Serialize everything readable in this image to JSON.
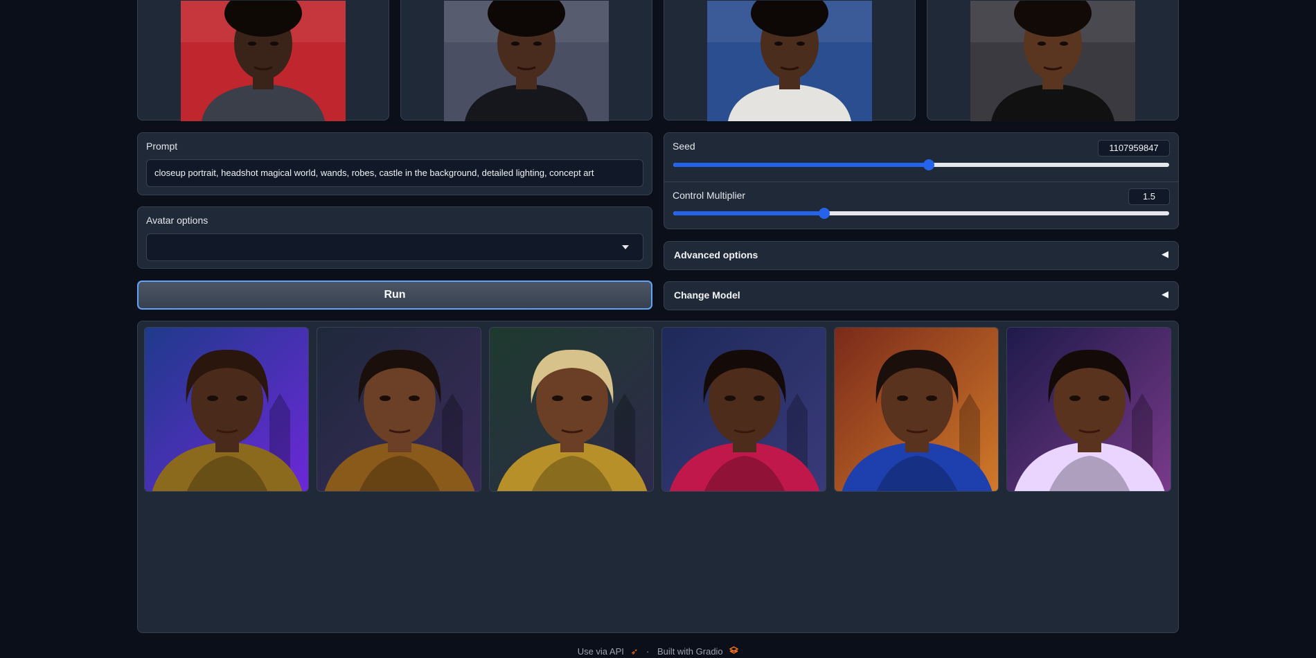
{
  "inputs": {
    "images": [
      {
        "name": "input-photo-1",
        "skin": "#3a2318",
        "bg": "#c0262d",
        "shirt": "#3a3f4a",
        "hair": "#0f0906"
      },
      {
        "name": "input-photo-2",
        "skin": "#4a2c1f",
        "bg": "#4a4f63",
        "shirt": "#15171c",
        "hair": "#0d0806"
      },
      {
        "name": "input-photo-3",
        "skin": "#4b2d1e",
        "bg": "#2a4e8f",
        "shirt": "#e5e3df",
        "hair": "#0d0806"
      },
      {
        "name": "input-photo-4",
        "skin": "#5a351f",
        "bg": "#3a3a40",
        "shirt": "#111111",
        "hair": "#120a06"
      }
    ]
  },
  "prompt": {
    "label": "Prompt",
    "value": "closeup portrait, headshot magical world, wands, robes, castle in the background, detailed lighting, concept art"
  },
  "avatar": {
    "label": "Avatar options",
    "value": ""
  },
  "run_button": {
    "label": "Run"
  },
  "seed": {
    "label": "Seed",
    "value": "1107959847",
    "fraction": 0.515
  },
  "control": {
    "label": "Control Multiplier",
    "value": "1.5",
    "fraction": 0.305
  },
  "advanced": {
    "label": "Advanced options",
    "caret": "◀"
  },
  "change_model": {
    "label": "Change Model",
    "caret": "◀"
  },
  "gallery": [
    {
      "bg1": "#1e3a8a",
      "bg2": "#6d28d9",
      "skin": "#4a2a1a",
      "hair": "#2a160c",
      "robe": "#8b6a1e"
    },
    {
      "bg1": "#1e293b",
      "bg2": "#3b2a5a",
      "skin": "#6b4026",
      "hair": "#1a0f0a",
      "robe": "#8a5a1a"
    },
    {
      "bg1": "#1e3a2e",
      "bg2": "#2e2a4a",
      "skin": "#6a3f26",
      "hair": "#d6c28a",
      "robe": "#b8902a"
    },
    {
      "bg1": "#1e2a5a",
      "bg2": "#3a3a7a",
      "skin": "#4d2c1c",
      "hair": "#140b08",
      "robe": "#c0184a"
    },
    {
      "bg1": "#7a2a1a",
      "bg2": "#d27a2a",
      "skin": "#5a331f",
      "hair": "#1a0f0a",
      "robe": "#1e40af"
    },
    {
      "bg1": "#1e1a4a",
      "bg2": "#7a3a8a",
      "skin": "#5a331f",
      "hair": "#140b08",
      "robe": "#e9d5ff"
    }
  ],
  "footer": {
    "api_label": "Use via API",
    "separator": "·",
    "built_label": "Built with Gradio"
  },
  "colors": {
    "accent": "#2563eb",
    "panel": "#1f2937",
    "background": "#0b0f19",
    "gradio_orange": "#f97316"
  }
}
